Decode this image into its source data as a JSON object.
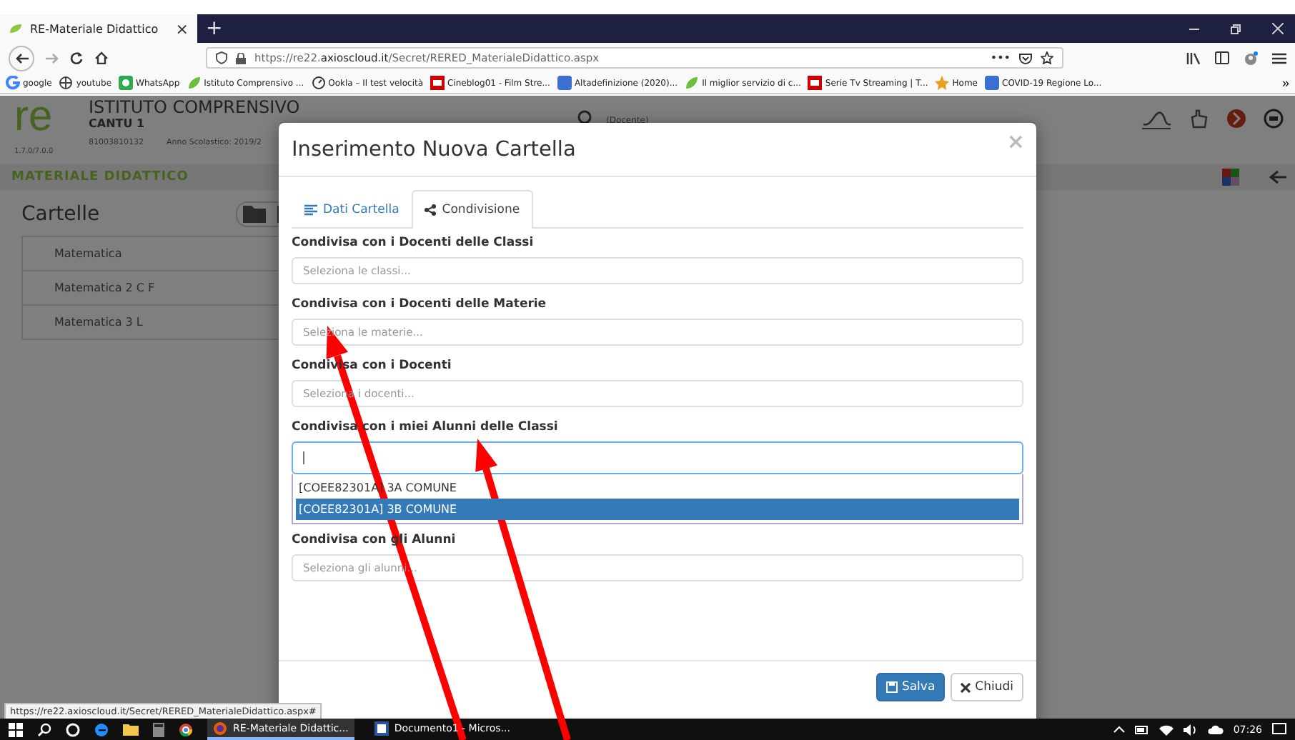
{
  "browser": {
    "tab_title": "RE-Materiale Didattico",
    "tab_close": "×",
    "new_tab": "+",
    "url_plain": "https://re22.",
    "url_domain": "axioscloud.it",
    "url_path": "/Secret/RERED_MaterialeDidattico.aspx",
    "page_actions": "•••",
    "bookmarks": [
      "google",
      "youtube",
      "WhatsApp",
      "Istituto Comprensivo ...",
      "Ookla – Il test velocità",
      "Cineblog01 - Film Stre...",
      "Altadefinizione (2020)...",
      "Il miglior servizio di c...",
      "Serie Tv Streaming | T...",
      "Home",
      "COVID-19 Regione Lo..."
    ],
    "bookmarks_more": "»",
    "status_url": "https://re22.axioscloud.it/Secret/RERED_MaterialeDidattico.aspx#"
  },
  "page": {
    "logo": "re",
    "school_name": "ISTITUTO COMPRENSIVO",
    "branch": "CANTU 1",
    "version": "1.7.0/7.0.0",
    "code": "81003810132",
    "year": "Anno Scolastico: 2019/2",
    "role": "(Docente)",
    "section_title": "MATERIALE DIDATTICO",
    "folders_title": "Cartelle",
    "folders": [
      "Matematica",
      "Matematica 2 C F",
      "Matematica 3 L"
    ]
  },
  "modal": {
    "title": "Inserimento Nuova Cartella",
    "close": "×",
    "tabs": [
      {
        "label": "Dati Cartella",
        "selected": false
      },
      {
        "label": "Condivisione",
        "selected": true
      }
    ],
    "fields": [
      {
        "kind": "select",
        "label": "Condivisa con i Docenti delle Classi",
        "placeholder": "Seleziona le classi..."
      },
      {
        "kind": "select",
        "label": "Condivisa con i Docenti delle Materie",
        "placeholder": "Seleziona le materie..."
      },
      {
        "kind": "select",
        "label": "Condivisa con i Docenti",
        "placeholder": "Seleziona i docenti..."
      },
      {
        "kind": "open",
        "label": "Condivisa con i miei Alunni delle Classi",
        "options": [
          {
            "label": "[COEE82301A] 3A COMUNE",
            "selected": false
          },
          {
            "label": "[COEE82301A] 3B COMUNE",
            "selected": true
          }
        ]
      },
      {
        "kind": "select",
        "label": "Condivisa con gli Alunni",
        "placeholder": "Seleziona gli alunni..."
      }
    ],
    "buttons": [
      {
        "label": "Salva",
        "kind": "primary"
      },
      {
        "label": "Chiudi",
        "kind": "default"
      }
    ]
  },
  "taskbar": {
    "apps": [
      {
        "label": "RE-Materiale Didattic...",
        "selected": true
      },
      {
        "label": "Documento1 - Micros...",
        "selected": false
      }
    ],
    "time": "07:26"
  }
}
